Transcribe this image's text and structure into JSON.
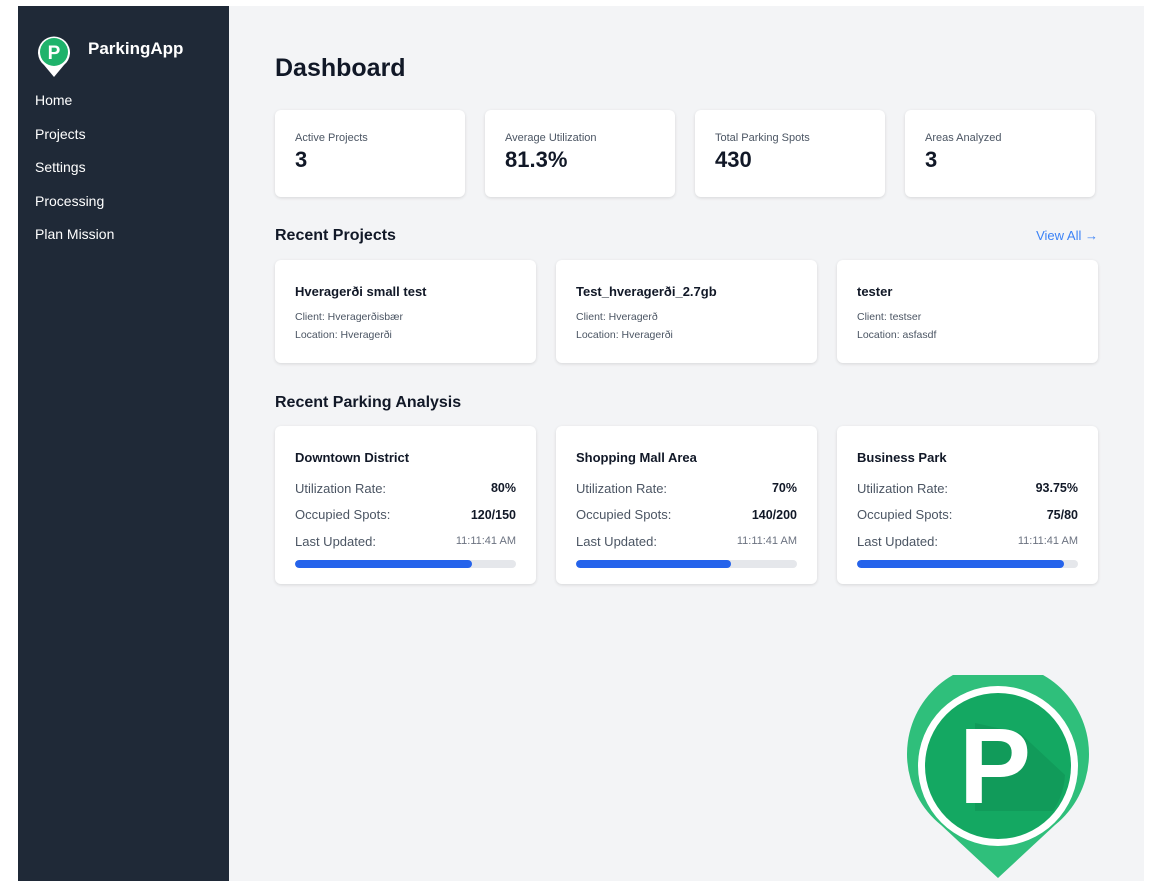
{
  "app": {
    "name": "ParkingApp",
    "logo_letter": "P"
  },
  "sidebar": {
    "items": [
      {
        "label": "Home"
      },
      {
        "label": "Projects"
      },
      {
        "label": "Settings"
      },
      {
        "label": "Processing"
      },
      {
        "label": "Plan Mission"
      }
    ]
  },
  "page": {
    "title": "Dashboard"
  },
  "stats": [
    {
      "label": "Active Projects",
      "value": "3"
    },
    {
      "label": "Average Utilization",
      "value": "81.3%"
    },
    {
      "label": "Total Parking Spots",
      "value": "430"
    },
    {
      "label": "Areas Analyzed",
      "value": "3"
    }
  ],
  "recent_projects": {
    "title": "Recent Projects",
    "view_all": "View All →",
    "items": [
      {
        "name": "Hveragerði small test",
        "client": "Client: Hveragerðisbær",
        "location": "Location: Hveragerði"
      },
      {
        "name": "Test_hveragerði_2.7gb",
        "client": "Client: Hveragerð",
        "location": "Location: Hveragerði"
      },
      {
        "name": "tester",
        "client": "Client: testser",
        "location": "Location: asfasdf"
      }
    ]
  },
  "recent_analysis": {
    "title": "Recent Parking Analysis",
    "labels": {
      "utilization": "Utilization Rate:",
      "occupied": "Occupied Spots:",
      "updated": "Last Updated:"
    },
    "items": [
      {
        "name": "Downtown District",
        "utilization": "80%",
        "occupied": "120/150",
        "updated": "11:11:41 AM",
        "fill": 0.8
      },
      {
        "name": "Shopping Mall Area",
        "utilization": "70%",
        "occupied": "140/200",
        "updated": "11:11:41 AM",
        "fill": 0.7
      },
      {
        "name": "Business Park",
        "utilization": "93.75%",
        "occupied": "75/80",
        "updated": "11:11:41 AM",
        "fill": 0.9375
      }
    ]
  },
  "colors": {
    "sidebar_bg": "#1f2937",
    "main_bg": "#f3f4f6",
    "accent": "#2563eb",
    "brand_green": "#1fb36b",
    "link": "#3b82f6"
  },
  "icons": {
    "brand": "parking-pin-icon",
    "watermark": "parking-pin-icon"
  }
}
